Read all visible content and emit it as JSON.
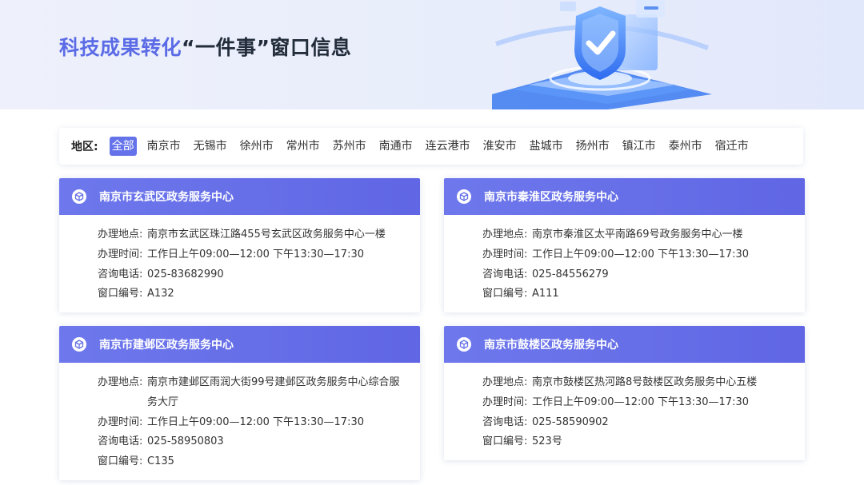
{
  "header": {
    "title_accent": "科技成果转化",
    "title_rest": "“一件事”窗口信息"
  },
  "filter": {
    "label": "地区:",
    "regions": [
      "全部",
      "南京市",
      "无锡市",
      "徐州市",
      "常州市",
      "苏州市",
      "南通市",
      "连云港市",
      "淮安市",
      "盐城市",
      "扬州市",
      "镇江市",
      "泰州市",
      "宿迁市"
    ],
    "selected": "全部"
  },
  "field_labels": {
    "address": "办理地点:",
    "hours": "办理时间:",
    "phone": "咨询电话:",
    "window": "窗口编号:"
  },
  "cards": [
    {
      "title": "南京市玄武区政务服务中心",
      "address": "南京市玄武区珠江路455号玄武区政务服务中心一楼",
      "hours": "工作日上午09:00—12:00 下午13:30—17:30",
      "phone": "025-83682990",
      "window": "A132"
    },
    {
      "title": "南京市秦淮区政务服务中心",
      "address": "南京市秦淮区太平南路69号政务服务中心一楼",
      "hours": "工作日上午09:00—12:00 下午13:30—17:30",
      "phone": "025-84556279",
      "window": "A111"
    },
    {
      "title": "南京市建邺区政务服务中心",
      "address": "南京市建邺区雨润大街99号建邺区政务服务中心综合服务大厅",
      "hours": "工作日上午09:00—12:00 下午13:30—17:30",
      "phone": "025-58950803",
      "window": "C135"
    },
    {
      "title": "南京市鼓楼区政务服务中心",
      "address": "南京市鼓楼区热河路8号鼓楼区政务服务中心五楼",
      "hours": "工作日上午09:00—12:00 下午13:30—17:30",
      "phone": "025-58590902",
      "window": "523号"
    }
  ]
}
